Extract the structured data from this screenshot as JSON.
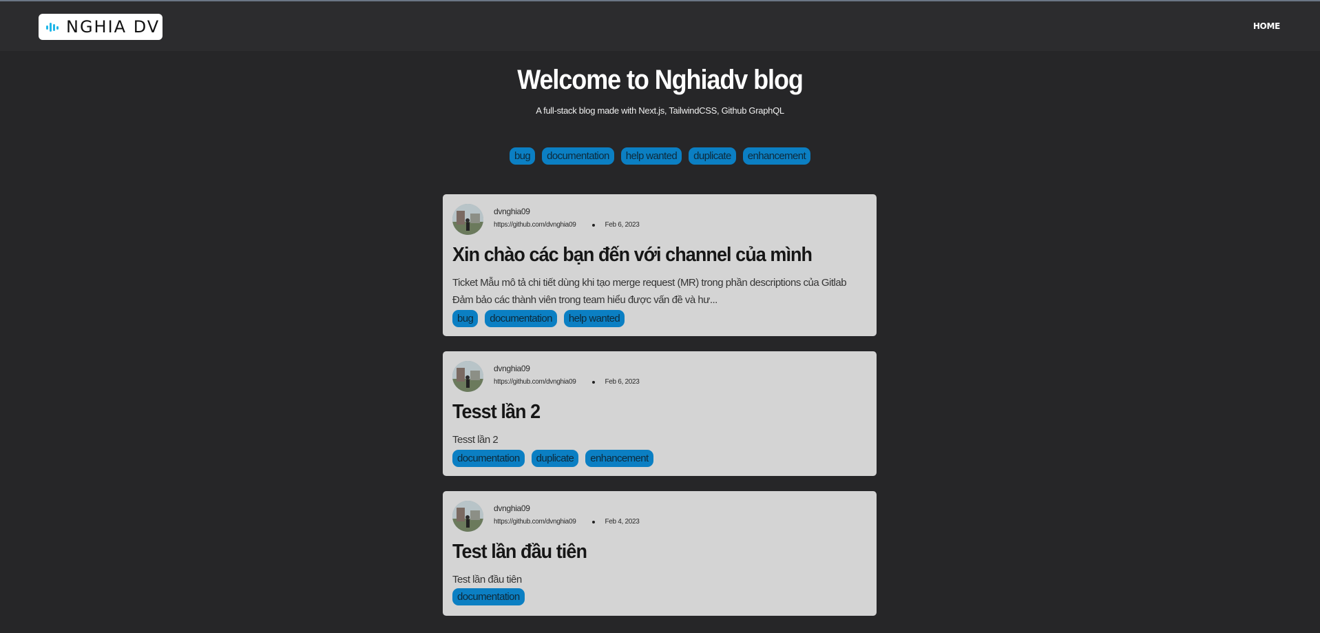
{
  "header": {
    "logo_text": "NGHIA DV",
    "nav_home": "HOME"
  },
  "hero": {
    "title": "Welcome to Nghiadv blog",
    "subtitle": "A full-stack blog made with Next.js, TailwindCSS, Github GraphQL"
  },
  "tags": [
    "bug",
    "documentation",
    "help wanted",
    "duplicate",
    "enhancement"
  ],
  "posts": [
    {
      "author": "dvnghia09",
      "url": "https://github.com/dvnghia09",
      "date": "Feb 6, 2023",
      "title": "Xin chào các bạn đến với channel của mình",
      "excerpt": "Ticket Mẫu mô tả chi tiết dùng khi tạo merge request (MR) trong phần descriptions của Gitlab Đảm bảo các thành viên trong team hiểu được vấn đề và hư...",
      "tags": [
        "bug",
        "documentation",
        "help wanted"
      ]
    },
    {
      "author": "dvnghia09",
      "url": "https://github.com/dvnghia09",
      "date": "Feb 6, 2023",
      "title": "Tesst lần 2",
      "excerpt": "Tesst lần 2",
      "tags": [
        "documentation",
        "duplicate",
        "enhancement"
      ]
    },
    {
      "author": "dvnghia09",
      "url": "https://github.com/dvnghia09",
      "date": "Feb 4, 2023",
      "title": "Test lần đầu tiên",
      "excerpt": "Test lần đầu tiên",
      "tags": [
        "documentation"
      ]
    }
  ],
  "colors": {
    "background": "#262628",
    "header": "#2c2c2e",
    "card": "#d4d4d4",
    "tag": "#0b7fc3",
    "logo_accent": "#1fb6e8"
  },
  "icons": {
    "logo": "sound-wave-icon",
    "avatar": "user-avatar-photo"
  }
}
